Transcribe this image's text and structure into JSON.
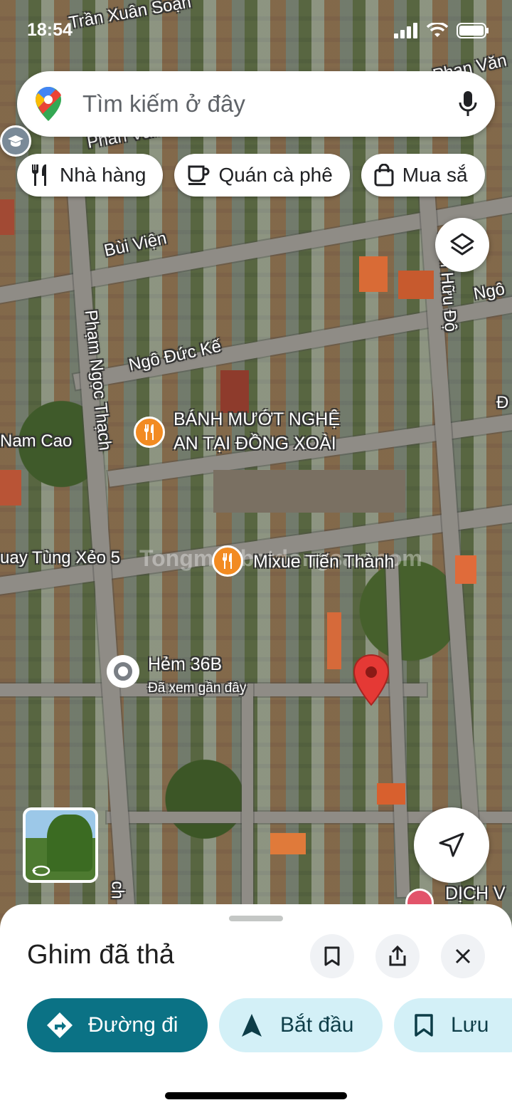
{
  "status_bar": {
    "time": "18:54"
  },
  "search": {
    "placeholder": "Tìm kiếm ở đây"
  },
  "chips": [
    {
      "label": "Nhà hàng",
      "icon": "restaurant-icon"
    },
    {
      "label": "Quán cà phê",
      "icon": "coffee-icon"
    },
    {
      "label": "Mua sắ",
      "icon": "shopping-bag-icon"
    }
  ],
  "map": {
    "streets": {
      "tran_xuan_soan": "Trần Xuân Soạn",
      "phan_van_top": "Phan Văn",
      "phan_van_left": "Phan Văn",
      "bui_vien": "Bùi Viện",
      "ngo_duc_ke": "Ngô Đức Kế",
      "pham_ngoc_thach": "Phạm Ngọc Thạch",
      "nam_cao": "Nam Cao",
      "trinh_huu_do": "Trịnh Hữu Độ",
      "ngo_right": "Ngô",
      "d_right": "Đ",
      "tung_xeo": "uay Tùng Xẻo 5",
      "bottom_ch": "ch"
    },
    "pois": {
      "banh_muot": {
        "line1": "BÁNH MƯỚT NGHỆ",
        "line2": "AN TẠI ĐỒNG XOÀI"
      },
      "mixue": "Mixue Tiến Thành",
      "hem36b": {
        "name": "Hẻm 36B",
        "sub": "Đã xem gần đây"
      },
      "dich_vu": "DỊCH V"
    },
    "watermark": "Tongmuabatdongsan.com"
  },
  "sheet": {
    "title": "Ghim đã thả",
    "buttons": {
      "directions": "Đường đi",
      "start": "Bắt đầu",
      "save": "Lưu"
    }
  },
  "colors": {
    "accent": "#0b7285",
    "pill_light": "#d3f0f7",
    "pin": "#e53935",
    "poi": "#f28b22"
  }
}
